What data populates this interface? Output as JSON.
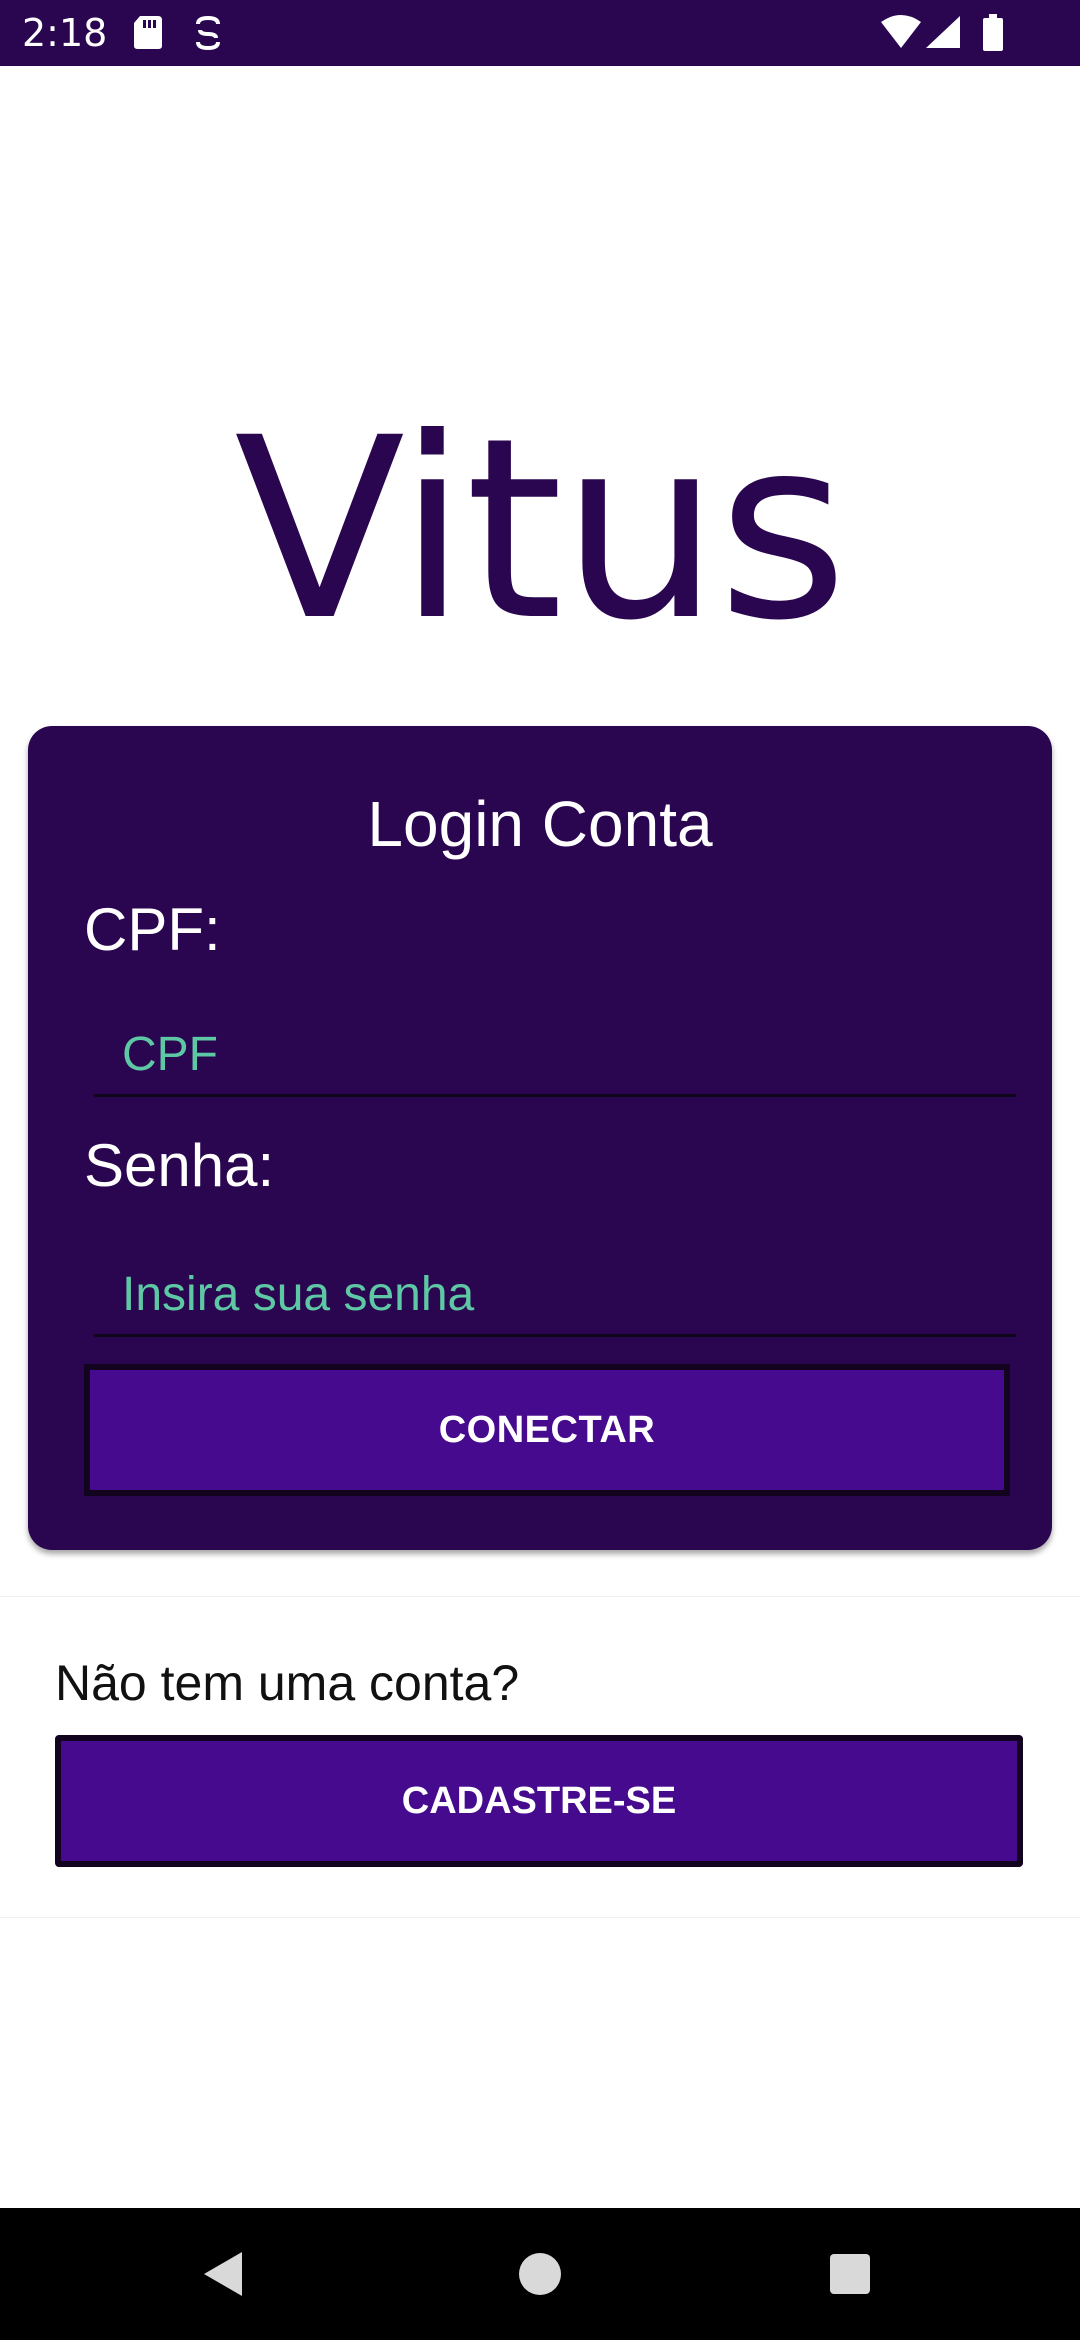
{
  "status_bar": {
    "time": "2:18",
    "icons": [
      "sd-card-icon",
      "sync-icon",
      "wifi-icon",
      "signal-icon",
      "battery-icon"
    ]
  },
  "app": {
    "title": "Vitus"
  },
  "login_card": {
    "title": "Login Conta",
    "cpf_label": "CPF:",
    "cpf_placeholder": "CPF",
    "senha_label": "Senha:",
    "senha_placeholder": "Insira sua senha",
    "connect_label": "CONECTAR"
  },
  "signup": {
    "question": "Não tem uma conta?",
    "button_label": "CADASTRE-SE"
  },
  "nav_bar": {
    "icons": [
      "back-icon",
      "home-icon",
      "recents-icon"
    ]
  },
  "colors": {
    "primary_dark": "#2b0650",
    "button": "#450a8d",
    "placeholder": "#5ec8a5"
  }
}
